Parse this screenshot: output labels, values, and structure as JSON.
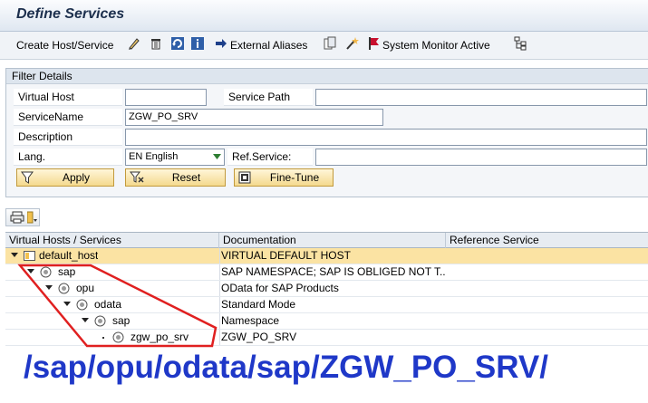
{
  "window": {
    "title": "Define Services"
  },
  "toolbar": {
    "create_label": "Create Host/Service",
    "external_aliases_label": "External Aliases",
    "system_monitor_label": "System Monitor Active"
  },
  "filter": {
    "legend": "Filter Details",
    "virtual_host_label": "Virtual Host",
    "virtual_host_value": "",
    "service_path_label": "Service Path",
    "service_path_value": "",
    "service_name_label": "ServiceName",
    "service_name_value": "ZGW_PO_SRV",
    "description_label": "Description",
    "description_value": "",
    "lang_label": "Lang.",
    "lang_value": "EN English",
    "ref_service_label": "Ref.Service:",
    "ref_service_value": "",
    "apply_label": "Apply",
    "reset_label": "Reset",
    "finetune_label": "Fine-Tune"
  },
  "grid": {
    "columns": [
      "Virtual Hosts / Services",
      "Documentation",
      "Reference Service"
    ],
    "rows": [
      {
        "name": "default_host",
        "doc": "VIRTUAL DEFAULT HOST",
        "ref": ""
      },
      {
        "name": "sap",
        "doc": "SAP NAMESPACE; SAP IS OBLIGED NOT T...",
        "ref": ""
      },
      {
        "name": "opu",
        "doc": "OData for SAP Products",
        "ref": ""
      },
      {
        "name": "odata",
        "doc": "Standard Mode",
        "ref": ""
      },
      {
        "name": "sap",
        "doc": "Namespace",
        "ref": ""
      },
      {
        "name": "zgw_po_srv",
        "doc": "ZGW_PO_SRV",
        "ref": ""
      }
    ]
  },
  "caption": "/sap/opu/odata/sap/ZGW_PO_SRV/",
  "colors": {
    "caption": "#1f38c8",
    "highlight_outline": "#e02020",
    "selected_row": "#fbe3a3",
    "button_fill": "#f4d98e"
  }
}
